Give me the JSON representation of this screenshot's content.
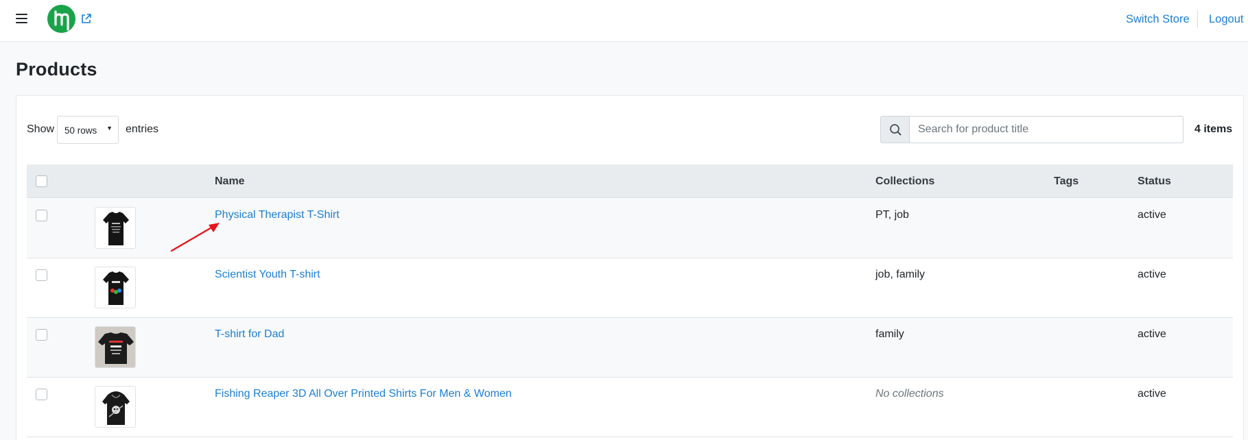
{
  "nav": {
    "switch_store": "Switch Store",
    "logout": "Logout"
  },
  "page": {
    "title": "Products"
  },
  "toolbar": {
    "show_label": "Show",
    "rows_selected": "50 rows",
    "entries_label": "entries",
    "search_placeholder": "Search for product title",
    "items_count": "4 items"
  },
  "table": {
    "headers": {
      "name": "Name",
      "collections": "Collections",
      "tags": "Tags",
      "status": "Status"
    },
    "rows": [
      {
        "name": "Physical Therapist T-Shirt",
        "collections": "PT, job",
        "tags": "",
        "status": "active"
      },
      {
        "name": "Scientist Youth T-shirt",
        "collections": "job, family",
        "tags": "",
        "status": "active"
      },
      {
        "name": "T-shirt for Dad",
        "collections": "family",
        "tags": "",
        "status": "active"
      },
      {
        "name": "Fishing Reaper 3D All Over Printed Shirts For Men & Women",
        "collections": "No collections",
        "tags": "",
        "status": "active"
      }
    ]
  },
  "colors": {
    "brand": "#1aa34a",
    "link": "#1a7fd4",
    "annotation_arrow": "#e8141b"
  }
}
